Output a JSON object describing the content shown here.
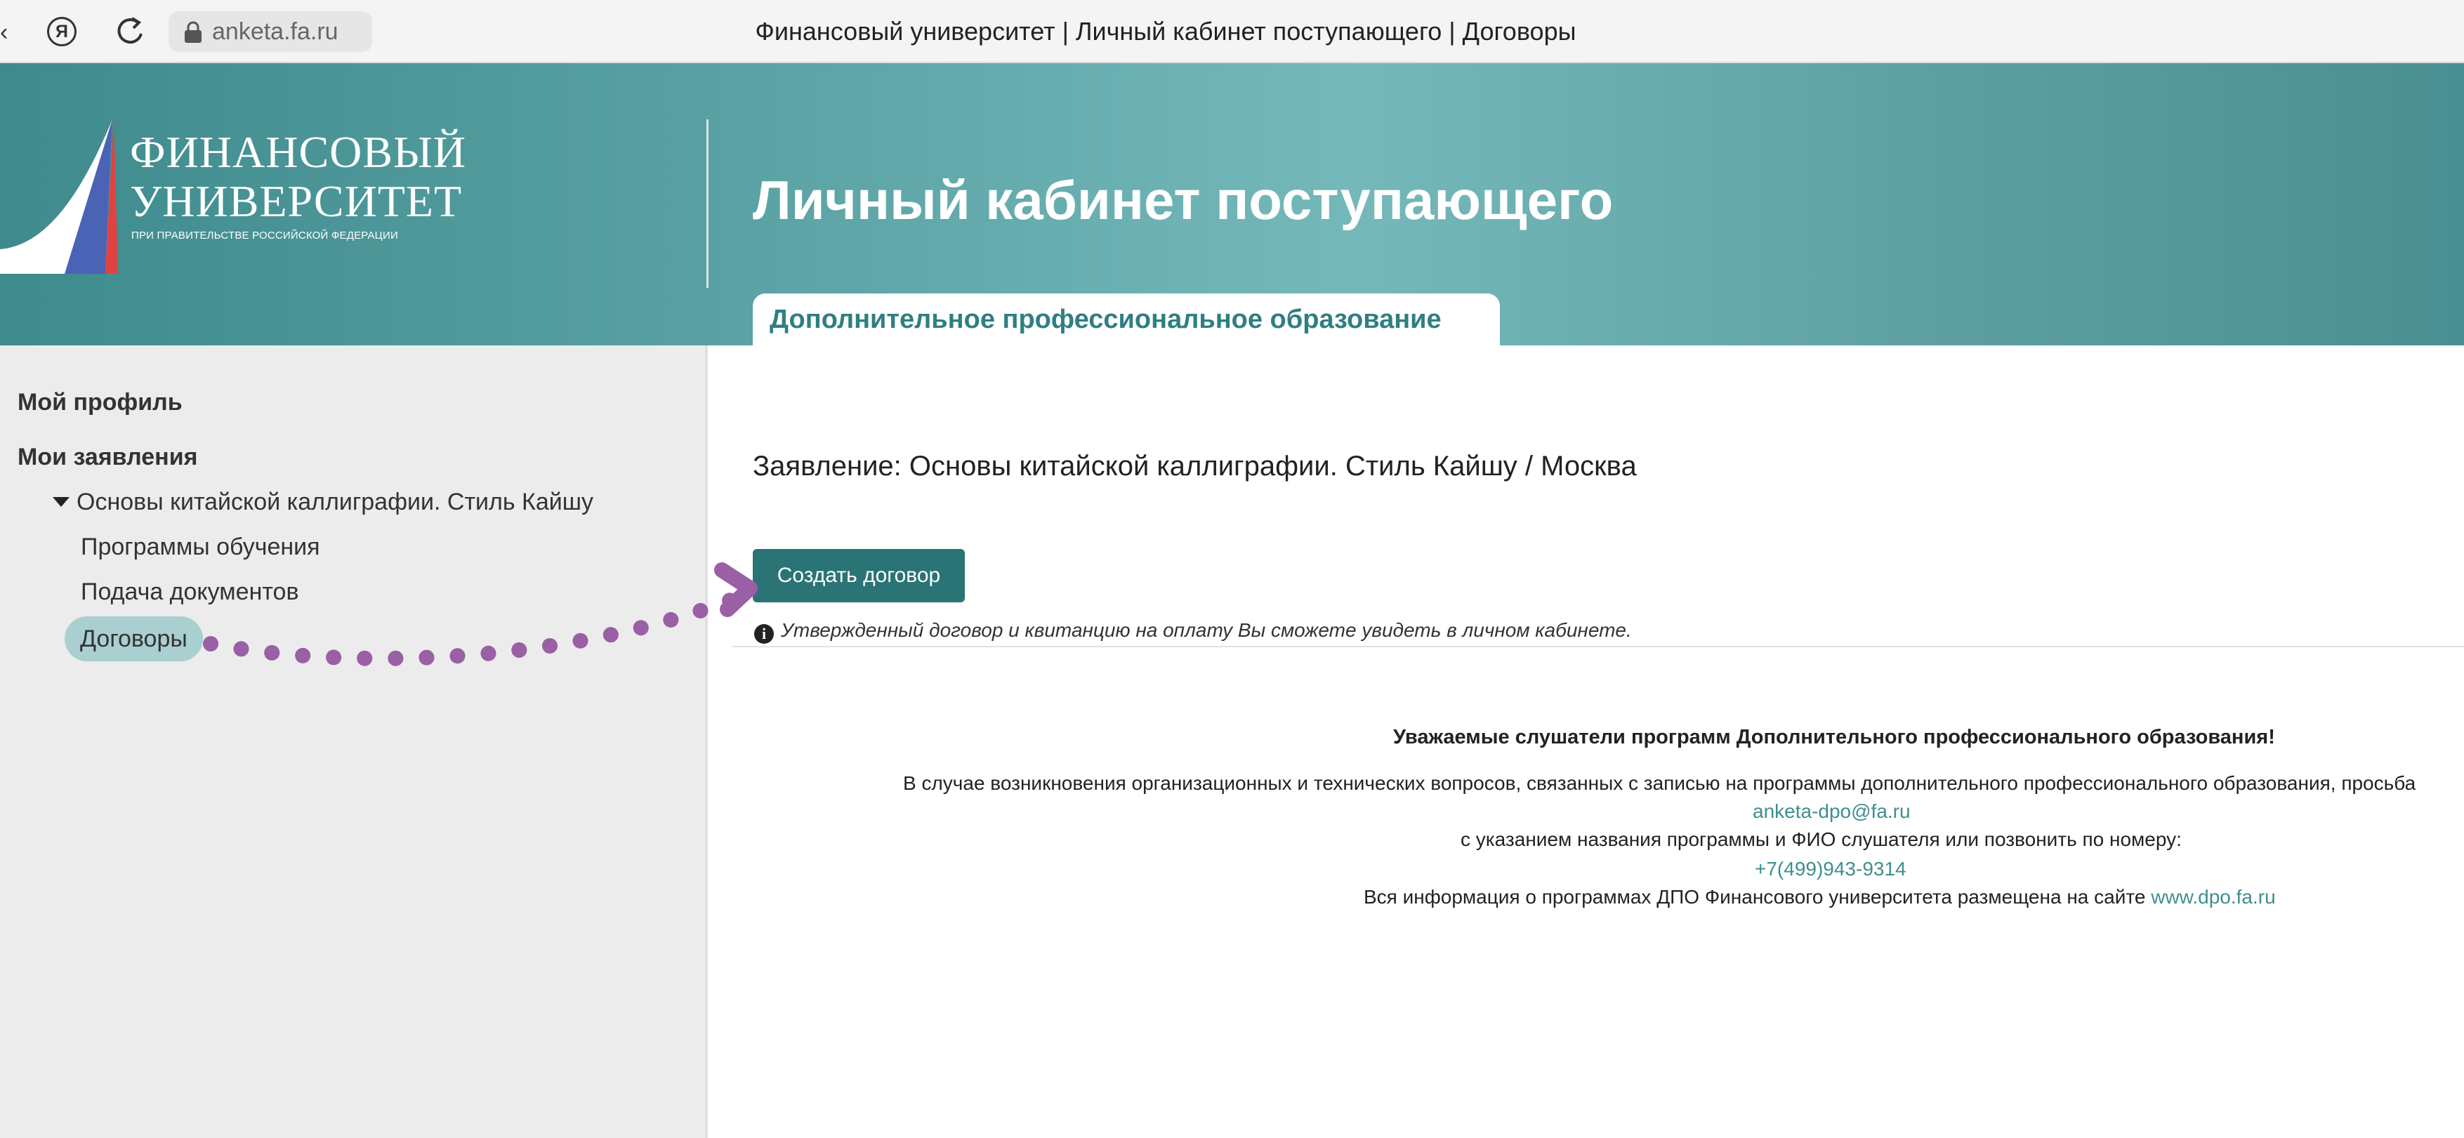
{
  "browser": {
    "url": "anketa.fa.ru",
    "title": "Финансовый университет | Личный кабинет поступающего | Договоры",
    "ya_label": "Я"
  },
  "header": {
    "logo_line1": "ФИНАНСОВЫЙ",
    "logo_line2": "УНИВЕРСИТЕТ",
    "logo_line3": "ПРИ ПРАВИТЕЛЬСТВЕ РОССИЙСКОЙ ФЕДЕРАЦИИ",
    "title": "Личный кабинет поступающего",
    "tab_label": "Дополнительное профессиональное образование"
  },
  "sidebar": {
    "profile": "Мой профиль",
    "applications": "Мои заявления",
    "course": "Основы китайской каллиграфии. Стиль Кайшу",
    "items": [
      {
        "label": "Программы обучения"
      },
      {
        "label": "Подача документов"
      },
      {
        "label": "Договоры"
      }
    ]
  },
  "main": {
    "application_title": "Заявление: Основы китайской каллиграфии. Стиль Кайшу / Москва",
    "create_button": "Создать договор",
    "hint_icon": "i",
    "hint": "Утвержденный договор и квитанцию на оплату Вы сможете увидеть в личном кабинете."
  },
  "notice": {
    "heading": "Уважаемые слушатели программ Дополнительного профессионального образования!",
    "line1": "В случае возникновения организационных и технических вопросов, связанных с записью на программы дополнительного профессионального образования, просьба",
    "email": "anketa-dpo@fa.ru",
    "line2": "с указанием названия программы и ФИО слушателя или позвонить по номеру:",
    "phone": "+7(499)943-9314",
    "line3": "Вся информация о программах ДПО Финансового университета размещена на сайте",
    "site": "www.dpo.fa.ru"
  },
  "colors": {
    "header_teal": "#5aa2a4",
    "button": "#2a7475",
    "link": "#3f8f8f",
    "active_pill": "#a9cfd0",
    "annotation": "#9b5fa6"
  },
  "icons": [
    "back-arrow-icon",
    "yandex-icon",
    "reload-icon",
    "lock-icon",
    "caret-down-icon",
    "info-icon",
    "annotation-arrow-icon"
  ]
}
